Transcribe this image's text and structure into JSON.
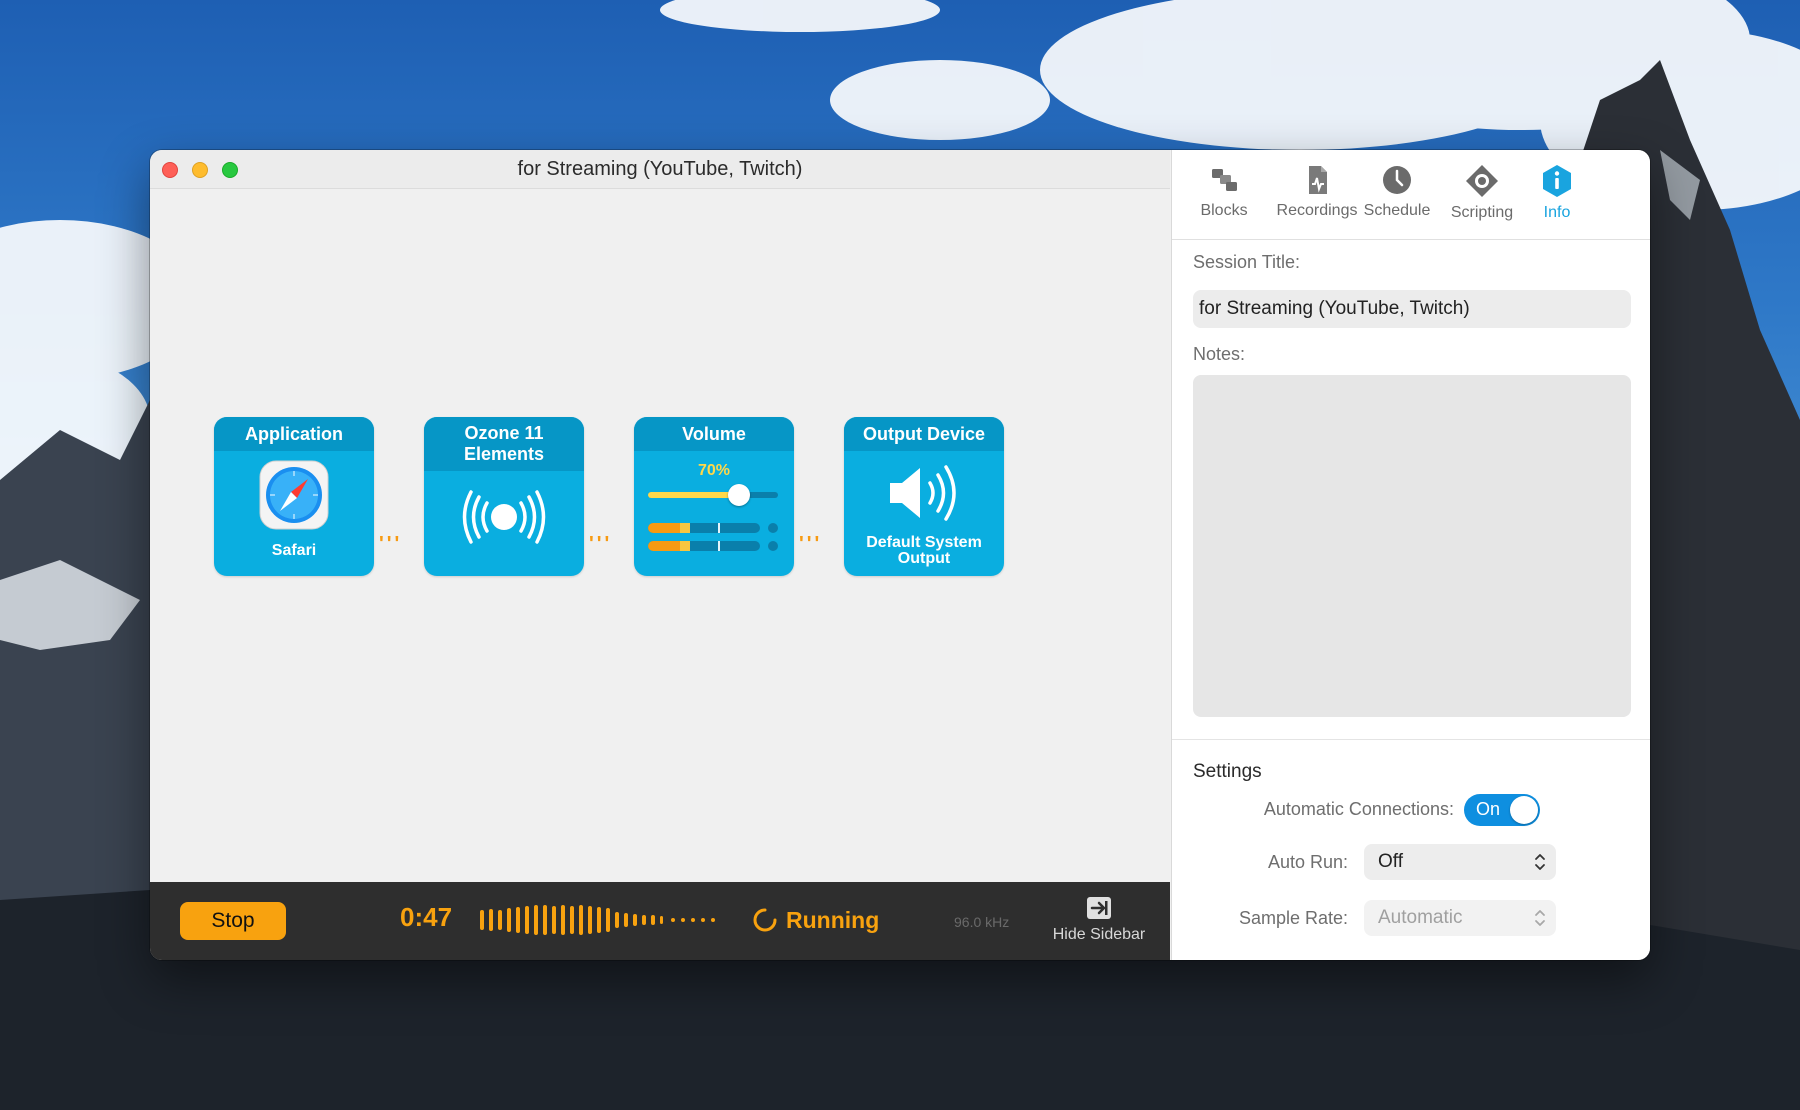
{
  "window": {
    "title": "for Streaming (YouTube, Twitch)"
  },
  "blocks": [
    {
      "header": "Application",
      "caption": "Safari",
      "icon": "safari-icon"
    },
    {
      "header": "Ozone 11 Elements",
      "caption": "",
      "icon": "broadcast-icon"
    },
    {
      "header": "Volume",
      "level_label": "70%",
      "level": 0.7,
      "icon": "volume-slider"
    },
    {
      "header": "Output Device",
      "caption": "Default System Output",
      "icon": "speaker-icon"
    }
  ],
  "statusbar": {
    "stop_label": "Stop",
    "elapsed": "0:47",
    "status": "Running",
    "sample_rate": "96.0 kHz",
    "hide_sidebar_label": "Hide Sidebar"
  },
  "sidebar": {
    "tabs": [
      {
        "label": "Blocks",
        "icon": "blocks-icon"
      },
      {
        "label": "Recordings",
        "icon": "recordings-icon"
      },
      {
        "label": "Schedule",
        "icon": "clock-icon"
      },
      {
        "label": "Scripting",
        "icon": "scripting-icon"
      },
      {
        "label": "Info",
        "icon": "info-icon",
        "active": true
      }
    ],
    "session_title_label": "Session Title:",
    "session_title_value": "for Streaming (YouTube, Twitch)",
    "notes_label": "Notes:",
    "notes_value": "",
    "settings_heading": "Settings",
    "auto_connections_label": "Automatic Connections:",
    "auto_connections_state": "On",
    "auto_run_label": "Auto Run:",
    "auto_run_value": "Off",
    "sample_rate_label": "Sample Rate:",
    "sample_rate_value": "Automatic"
  },
  "colors": {
    "accent_orange": "#f8a20f",
    "block_blue": "#0aaee0",
    "block_header": "#0696c6",
    "info_blue": "#19a4df",
    "toggle_on": "#0e8fe0"
  }
}
